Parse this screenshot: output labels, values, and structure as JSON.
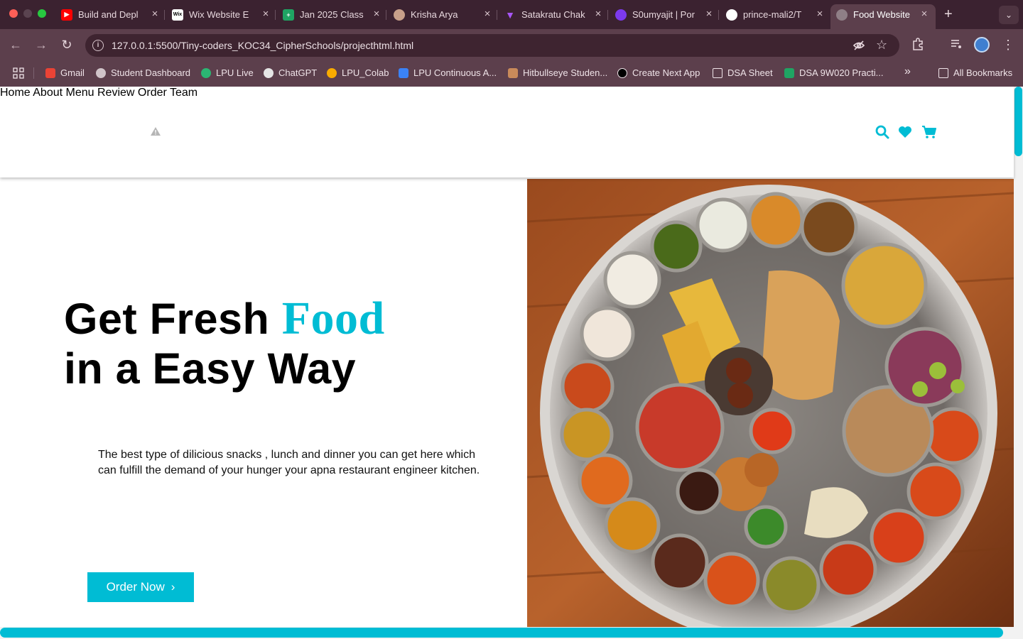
{
  "browser": {
    "tabs": [
      {
        "label": "Build and Depl",
        "icon": "youtube-icon",
        "color": "#ff0000"
      },
      {
        "label": "Wix Website E",
        "icon": "wix-icon",
        "color": "#ffffff"
      },
      {
        "label": "Jan 2025 Class",
        "icon": "sheets-icon",
        "color": "#1fa463"
      },
      {
        "label": "Krisha Arya",
        "icon": "person-icon",
        "color": "#c8a08a"
      },
      {
        "label": "Satakratu Chak",
        "icon": "vite-icon",
        "color": "#a855f7"
      },
      {
        "label": "S0umyajit | Por",
        "icon": "portfolio-icon",
        "color": "#7c3aed"
      },
      {
        "label": "prince-mali2/T",
        "icon": "github-icon",
        "color": "#ffffff"
      },
      {
        "label": "Food Website",
        "icon": "globe-icon",
        "color": "#c9c9c9"
      }
    ],
    "url": "127.0.0.1:5500/Tiny-coders_KOC34_CipherSchools/projecthtml.html",
    "new_tab": "+",
    "bookmarks": [
      {
        "label": "Gmail",
        "icon": "gmail-icon",
        "color": "#ea4335"
      },
      {
        "label": "Student Dashboard",
        "icon": "globe-icon",
        "color": "#d0c4c9"
      },
      {
        "label": "LPU Live",
        "icon": "lpu-live-icon",
        "color": "#2bb673"
      },
      {
        "label": "ChatGPT",
        "icon": "chatgpt-icon",
        "color": "#e5e5e5"
      },
      {
        "label": "LPU_Colab",
        "icon": "colab-icon",
        "color": "#f9ab00"
      },
      {
        "label": "LPU Continuous A...",
        "icon": "edit-icon",
        "color": "#3b82f6"
      },
      {
        "label": "Hitbullseye Studen...",
        "icon": "hitbullseye-icon",
        "color": "#c98a5a"
      },
      {
        "label": "Create Next App",
        "icon": "nextjs-icon",
        "color": "#000000"
      },
      {
        "label": "DSA Sheet",
        "icon": "folder-icon",
        "color": "#efe3e8"
      },
      {
        "label": "DSA 9W020 Practi...",
        "icon": "sheets-icon",
        "color": "#1fa463"
      }
    ],
    "overflow": "»",
    "all_bookmarks": "All Bookmarks"
  },
  "site": {
    "nav": [
      "Home",
      "About",
      "Menu",
      "Review",
      "Order",
      "Team"
    ],
    "accent": "#00bcd4",
    "hero": {
      "title_part1": "Get Fresh ",
      "title_accent": "Food",
      "title_line2": "in a Easy Way",
      "description": "The best type of dilicious snacks , lunch and dinner you can get here which can fulfill the demand of your hunger your apna restaurant engineer kitchen.",
      "button": "Order Now",
      "button_chevron": "›"
    }
  }
}
